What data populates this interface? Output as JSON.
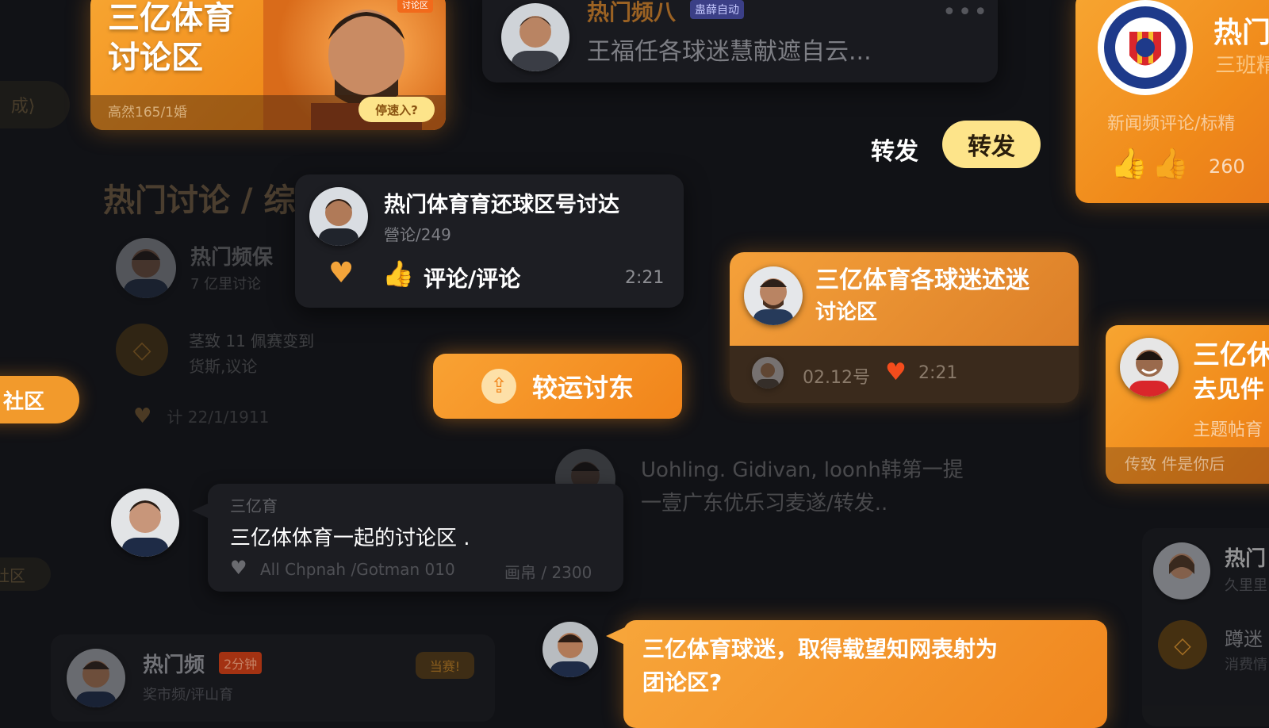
{
  "colors": {
    "background": "#111216",
    "accent_orange": "#f39222",
    "card_dark": "#1c1d22",
    "highlight_yellow": "#fde48a"
  },
  "banner_card": {
    "title_line1": "三亿体育",
    "title_line2": "讨论区",
    "footer_text": "高然165/1婚",
    "join_button": "停速入?",
    "badge": "讨论区"
  },
  "top_post": {
    "title": "热门频八",
    "badge": "蛊薛自动",
    "text": "王福任各球迷慧献遮自云...",
    "more_icon": "more-dots-icon"
  },
  "left_edge": {
    "chip_top": "成⟩",
    "chip_mid": "社区",
    "chip_bottom": "社区"
  },
  "share_row": {
    "label": "转发",
    "button": "转发"
  },
  "right_club_card": {
    "title": "热门",
    "subtitle": "三班精",
    "caption": "新闻频评论/标精",
    "count": "260",
    "crest_icon": "club-crest-icon"
  },
  "hot_section": {
    "heading": "热门讨论 / 综",
    "item1_title": "热门频保",
    "item1_sub": "7 亿里讨论",
    "item2_title": "茎致 11 佩赛变到",
    "item2_sub": "货斯,议论",
    "item3_text": "计 22/1/1911"
  },
  "discussion_card": {
    "title": "热门体育育还球区号讨达",
    "subtitle": "營论/249",
    "action_label": "评论/评论",
    "time": "2:21"
  },
  "cta_button": {
    "label": "较运讨东",
    "icon": "share-icon"
  },
  "fan_card": {
    "title_line1": "三亿体育各球迷述迷",
    "title_line2": "讨论区",
    "date": "02.12号",
    "time": "2:21"
  },
  "right_small_card": {
    "title_line1": "三亿休",
    "title_line2": "去见件",
    "sub": "主题帖育",
    "footer": "传致 件是你后"
  },
  "ghost_msg": {
    "line1": "Uohling. Gidivan, loonh韩第一提",
    "line2": "一壹广东优乐习麦遂/转发.."
  },
  "chat_bubble": {
    "sender": "三亿育",
    "text": "三亿体体育一起的讨论区 .",
    "meta": "All Chpnah /Gotman 010",
    "count": "画帛 / 2300"
  },
  "bottom_post": {
    "title": "热门频",
    "badge": "2分钟",
    "sub": "奖市频/评山育",
    "tag": "当赛!"
  },
  "orange_bubble": {
    "line1": "三亿体育球迷，取得载望知网表射为",
    "line2": "团论区?"
  },
  "right_bottom": {
    "title": "热门",
    "sub": "久里里",
    "item": "蹲迷",
    "item_sub": "消费情"
  }
}
